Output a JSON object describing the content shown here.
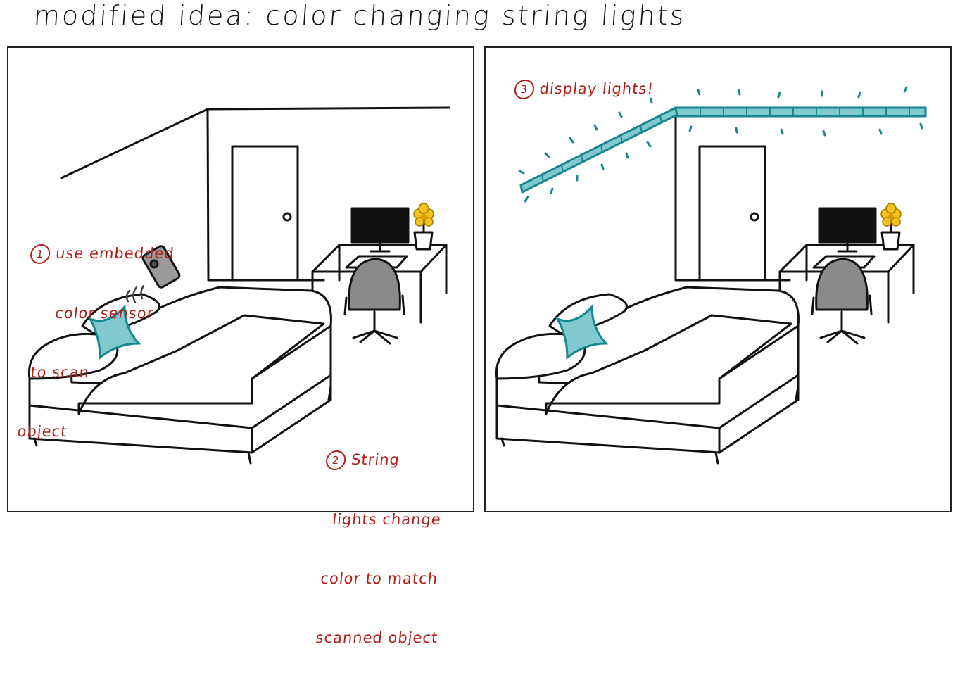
{
  "title": "modified idea: color changing string lights",
  "panel1": {
    "step1": {
      "number": "1",
      "lines": [
        "use embedded",
        "color sensor",
        "to scan",
        "object"
      ]
    },
    "step2": {
      "number": "2",
      "lines": [
        "String",
        "lights change",
        "color to match",
        "scanned object"
      ]
    }
  },
  "panel2": {
    "step3": {
      "number": "3",
      "text": "display lights!"
    }
  },
  "colors": {
    "annotation": "#b0201a",
    "teal": "#7fc9cf",
    "teal_dark": "#17868f",
    "flower": "#f3c21b",
    "ink": "#111111"
  }
}
